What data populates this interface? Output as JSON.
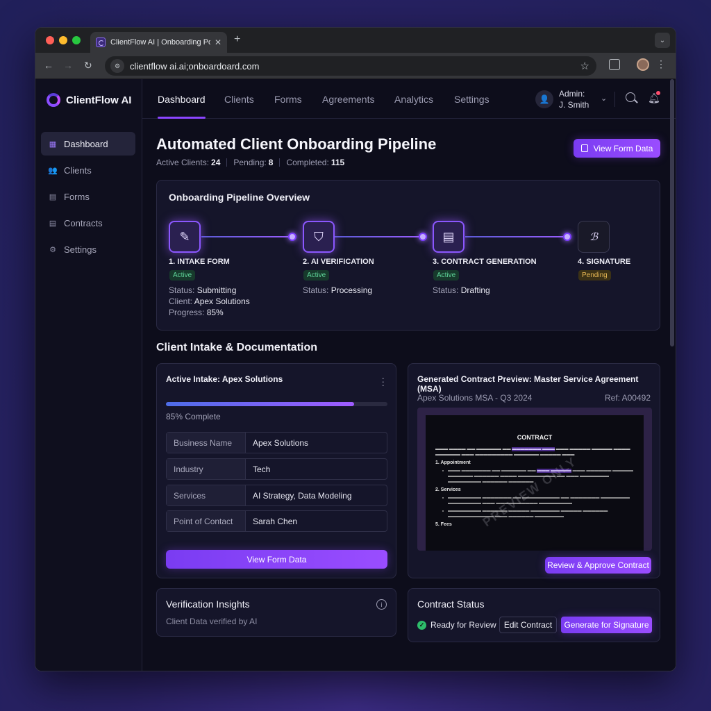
{
  "browser": {
    "tab_title": "ClientFlow AI | Onboarding Po",
    "tab_close": "✕",
    "new_tab": "+",
    "url": "clientflow ai.ai;onboardoard.com"
  },
  "app": {
    "brand": "ClientFlow AI",
    "sidebar": {
      "items": [
        {
          "label": "Dashboard",
          "icon": "grid-icon"
        },
        {
          "label": "Clients",
          "icon": "users-icon"
        },
        {
          "label": "Forms",
          "icon": "document-icon"
        },
        {
          "label": "Contracts",
          "icon": "contract-icon"
        },
        {
          "label": "Settings",
          "icon": "gear-icon"
        }
      ]
    },
    "topnav": {
      "tabs": [
        "Dashboard",
        "Clients",
        "Forms",
        "Agreements",
        "Analytics",
        "Settings"
      ],
      "admin_role": "Admin:",
      "admin_name": "J. Smith"
    }
  },
  "page": {
    "title": "Automated Client Onboarding Pipeline",
    "stats": {
      "active_label": "Active Clients:",
      "active_value": "24",
      "pending_label": "Pending:",
      "pending_value": "8",
      "completed_label": "Completed:",
      "completed_value": "115"
    },
    "view_form_data_btn": "View Form Data"
  },
  "pipeline": {
    "title": "Onboarding Pipeline Overview",
    "stages": [
      {
        "label": "1. INTAKE FORM",
        "badge": "Active",
        "lines": [
          [
            "Status:",
            "Submitting"
          ],
          [
            "Client:",
            "Apex Solutions"
          ],
          [
            "Progress:",
            "85%"
          ]
        ]
      },
      {
        "label": "2. AI VERIFICATION",
        "badge": "Active",
        "lines": [
          [
            "Status:",
            "Processing"
          ]
        ]
      },
      {
        "label": "3. CONTRACT GENERATION",
        "badge": "Active",
        "lines": [
          [
            "Status:",
            "Drafting"
          ]
        ]
      },
      {
        "label": "4. SIGNATURE",
        "badge": "Pending",
        "lines": []
      }
    ]
  },
  "section_title": "Client Intake & Documentation",
  "intake": {
    "title": "Active Intake: Apex Solutions",
    "progress": 0.85,
    "progress_text": "85% Complete",
    "fields": [
      {
        "k": "Business Name",
        "v": "Apex Solutions"
      },
      {
        "k": "Industry",
        "v": "Tech"
      },
      {
        "k": "Services",
        "v": "AI Strategy, Data Modeling"
      },
      {
        "k": "Point of Contact",
        "v": "Sarah Chen"
      }
    ],
    "button": "View Form Data"
  },
  "contract_preview": {
    "title": "Generated Contract Preview: Master Service Agreement (MSA)",
    "subtitle": "Apex Solutions MSA - Q3 2024",
    "ref": "Ref: A00492",
    "doc_heading": "CONTRACT",
    "sec1": "1. Appointment",
    "sec2": "2. Services",
    "sec3": "5. Fees",
    "watermark": "PREVIEW ONLY",
    "button": "Review & Approve Contract"
  },
  "verification": {
    "title": "Verification Insights",
    "subtitle": "Client Data verified by AI"
  },
  "contract_status": {
    "title": "Contract Status",
    "status": "Ready for Review",
    "edit_btn": "Edit Contract",
    "sign_btn": "Generate for Signature"
  }
}
